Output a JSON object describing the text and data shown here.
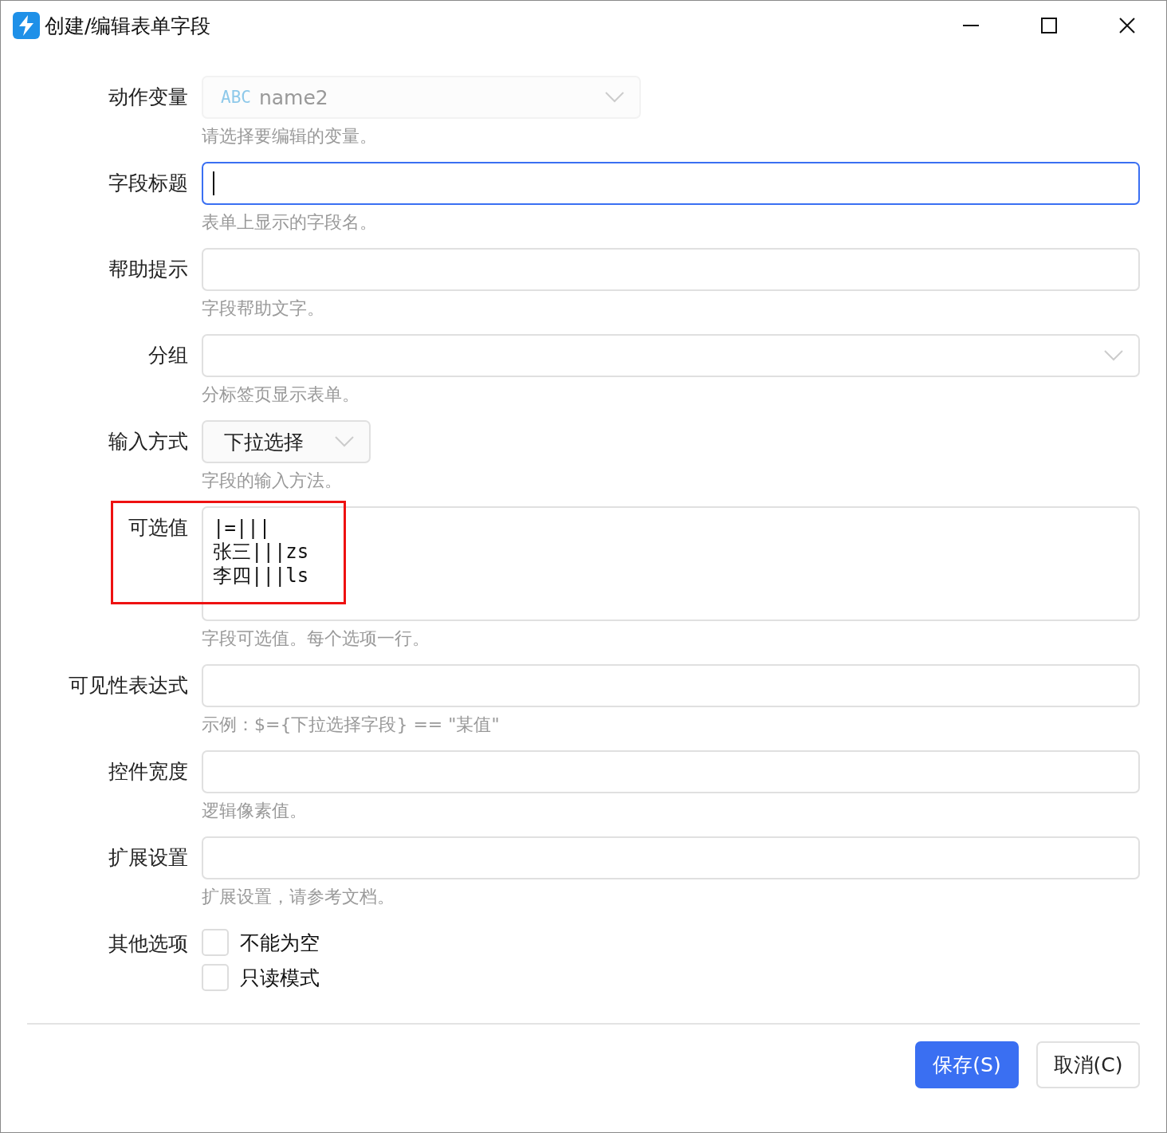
{
  "window": {
    "title": "创建/编辑表单字段"
  },
  "fields": [
    {
      "kind": "select",
      "label": "动作变量",
      "type_badge": "ABC",
      "value": "name2",
      "disabled": true,
      "compact": false,
      "hint": "请选择要编辑的变量。"
    },
    {
      "kind": "text",
      "label": "字段标题",
      "focused": true,
      "hint": "表单上显示的字段名。"
    },
    {
      "kind": "text",
      "label": "帮助提示",
      "focused": false,
      "hint": "字段帮助文字。"
    },
    {
      "kind": "select",
      "label": "分组",
      "disabled": false,
      "compact": false,
      "hint": "分标签页显示表单。"
    },
    {
      "kind": "select",
      "label": "输入方式",
      "value": "下拉选择",
      "disabled": false,
      "compact": true,
      "hint": "字段的输入方法。"
    },
    {
      "kind": "textarea",
      "label": "可选值",
      "highlighted": true,
      "lines": [
        "|=|||",
        "张三|||zs",
        "李四|||ls"
      ],
      "hint": "字段可选值。每个选项一行。"
    },
    {
      "kind": "text",
      "label": "可见性表达式",
      "focused": false,
      "hint": "示例：$={下拉选择字段} == \"某值\""
    },
    {
      "kind": "text",
      "label": "控件宽度",
      "focused": false,
      "hint": "逻辑像素值。"
    },
    {
      "kind": "text",
      "label": "扩展设置",
      "focused": false,
      "hint": "扩展设置，请参考文档。"
    },
    {
      "kind": "checks",
      "label": "其他选项",
      "options": [
        {
          "label": "不能为空",
          "checked": false
        },
        {
          "label": "只读模式",
          "checked": false
        }
      ]
    }
  ],
  "buttons": [
    {
      "label": "保存(S)",
      "primary": true
    },
    {
      "label": "取消(C)",
      "primary": false
    }
  ]
}
